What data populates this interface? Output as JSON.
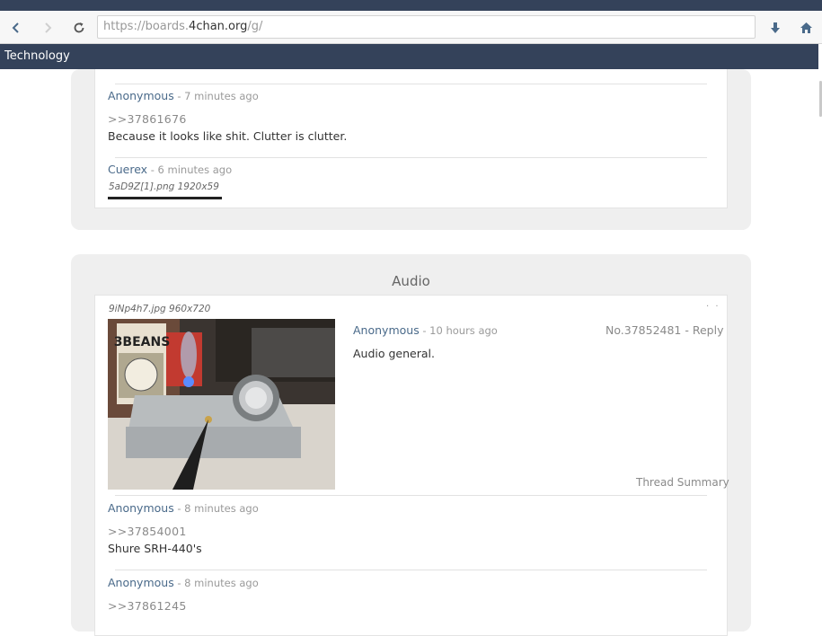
{
  "browser": {
    "url_prefix": "https://boards.",
    "url_domain": "4chan.org",
    "url_suffix": "/g/",
    "icons": [
      "back-icon",
      "forward-icon",
      "reload-icon",
      "download-icon",
      "home-icon"
    ]
  },
  "app": {
    "board_title": "Technology"
  },
  "thread1": {
    "posts": [
      {
        "author": "Anonymous",
        "time": " - 7 minutes ago",
        "quote": ">>37861676",
        "text": "Because it looks like shit. Clutter is clutter."
      },
      {
        "author": "Cuerex",
        "time": " - 6 minutes ago",
        "file": "5aD9Z[1].png 1920x59"
      }
    ]
  },
  "thread2": {
    "title": "Audio",
    "op": {
      "file": "9iNp4h7.jpg 960x720",
      "author": "Anonymous",
      "time": " - 10 hours ago",
      "number": "No.37852481",
      "separator": " - ",
      "reply": "Reply",
      "text": "Audio general.",
      "summary": "Thread Summary",
      "image_text": "3BEANS"
    },
    "replies": [
      {
        "author": "Anonymous",
        "time": " - 8 minutes ago",
        "quote": ">>37854001",
        "text": "Shure SRH-440's"
      },
      {
        "author": "Anonymous",
        "time": " - 8 minutes ago",
        "quote": ">>37861245"
      }
    ]
  },
  "colors": {
    "header": "#34425a",
    "author": "#4a6a8a",
    "muted": "#9a9a9a"
  }
}
